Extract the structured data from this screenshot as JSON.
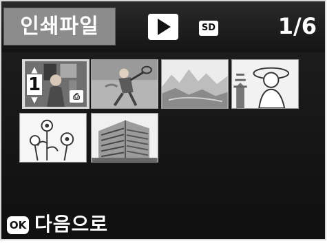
{
  "header": {
    "title": "인쇄파일",
    "play_icon": "play-icon",
    "media_badge": "SD",
    "counter": "1/6"
  },
  "thumbnails": [
    {
      "subject": "woman-in-room",
      "selected": true,
      "print_quantity": "1",
      "print_badge": "DPOF"
    },
    {
      "subject": "tennis-player",
      "selected": false
    },
    {
      "subject": "mountain-landscape",
      "selected": false
    },
    {
      "subject": "woman-with-hat-pagoda",
      "selected": false
    },
    {
      "subject": "flowers-sketch",
      "selected": false
    },
    {
      "subject": "apartment-building",
      "selected": false
    }
  ],
  "footer": {
    "ok_icon": "OK",
    "hint": "다음으로"
  },
  "colors": {
    "background": "#111111",
    "title_tab": "#8c8c8c",
    "text": "#ffffff"
  }
}
